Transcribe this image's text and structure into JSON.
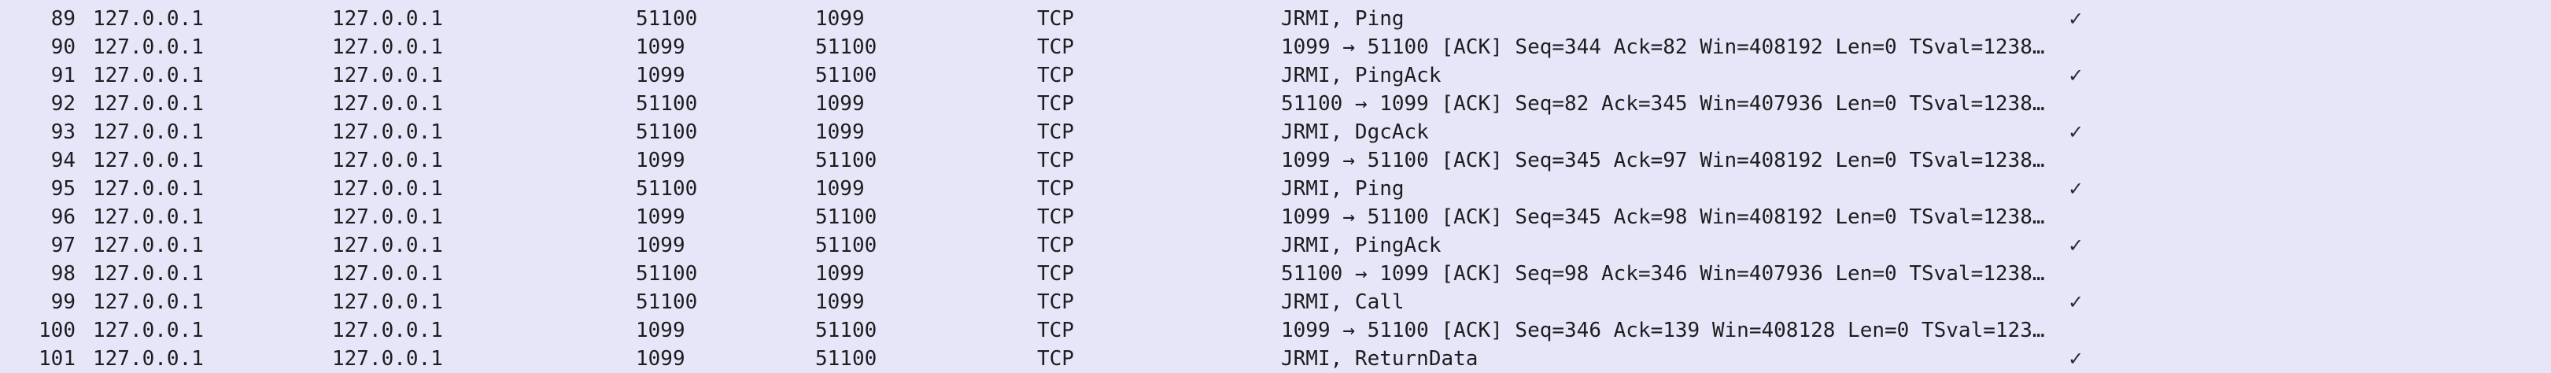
{
  "packets": [
    {
      "no": "89",
      "src": "127.0.0.1",
      "dst": "127.0.0.1",
      "sport": "51100",
      "dport": "1099",
      "proto": "TCP",
      "info": "JRMI, Ping",
      "check": "✓"
    },
    {
      "no": "90",
      "src": "127.0.0.1",
      "dst": "127.0.0.1",
      "sport": "1099",
      "dport": "51100",
      "proto": "TCP",
      "info": "1099 → 51100 [ACK] Seq=344 Ack=82 Win=408192 Len=0 TSval=1238…",
      "check": ""
    },
    {
      "no": "91",
      "src": "127.0.0.1",
      "dst": "127.0.0.1",
      "sport": "1099",
      "dport": "51100",
      "proto": "TCP",
      "info": "JRMI, PingAck",
      "check": "✓"
    },
    {
      "no": "92",
      "src": "127.0.0.1",
      "dst": "127.0.0.1",
      "sport": "51100",
      "dport": "1099",
      "proto": "TCP",
      "info": "51100 → 1099 [ACK] Seq=82 Ack=345 Win=407936 Len=0 TSval=1238…",
      "check": ""
    },
    {
      "no": "93",
      "src": "127.0.0.1",
      "dst": "127.0.0.1",
      "sport": "51100",
      "dport": "1099",
      "proto": "TCP",
      "info": "JRMI, DgcAck",
      "check": "✓"
    },
    {
      "no": "94",
      "src": "127.0.0.1",
      "dst": "127.0.0.1",
      "sport": "1099",
      "dport": "51100",
      "proto": "TCP",
      "info": "1099 → 51100 [ACK] Seq=345 Ack=97 Win=408192 Len=0 TSval=1238…",
      "check": ""
    },
    {
      "no": "95",
      "src": "127.0.0.1",
      "dst": "127.0.0.1",
      "sport": "51100",
      "dport": "1099",
      "proto": "TCP",
      "info": "JRMI, Ping",
      "check": "✓"
    },
    {
      "no": "96",
      "src": "127.0.0.1",
      "dst": "127.0.0.1",
      "sport": "1099",
      "dport": "51100",
      "proto": "TCP",
      "info": "1099 → 51100 [ACK] Seq=345 Ack=98 Win=408192 Len=0 TSval=1238…",
      "check": ""
    },
    {
      "no": "97",
      "src": "127.0.0.1",
      "dst": "127.0.0.1",
      "sport": "1099",
      "dport": "51100",
      "proto": "TCP",
      "info": "JRMI, PingAck",
      "check": "✓"
    },
    {
      "no": "98",
      "src": "127.0.0.1",
      "dst": "127.0.0.1",
      "sport": "51100",
      "dport": "1099",
      "proto": "TCP",
      "info": "51100 → 1099 [ACK] Seq=98 Ack=346 Win=407936 Len=0 TSval=1238…",
      "check": ""
    },
    {
      "no": "99",
      "src": "127.0.0.1",
      "dst": "127.0.0.1",
      "sport": "51100",
      "dport": "1099",
      "proto": "TCP",
      "info": "JRMI, Call",
      "check": "✓"
    },
    {
      "no": "100",
      "src": "127.0.0.1",
      "dst": "127.0.0.1",
      "sport": "1099",
      "dport": "51100",
      "proto": "TCP",
      "info": "1099 → 51100 [ACK] Seq=346 Ack=139 Win=408128 Len=0 TSval=123…",
      "check": ""
    },
    {
      "no": "101",
      "src": "127.0.0.1",
      "dst": "127.0.0.1",
      "sport": "1099",
      "dport": "51100",
      "proto": "TCP",
      "info": "JRMI, ReturnData",
      "check": "✓"
    }
  ],
  "colors": {
    "row_background": "#e7e6f8",
    "text": "#1d1d20"
  },
  "icons": {
    "check": "check-icon"
  }
}
